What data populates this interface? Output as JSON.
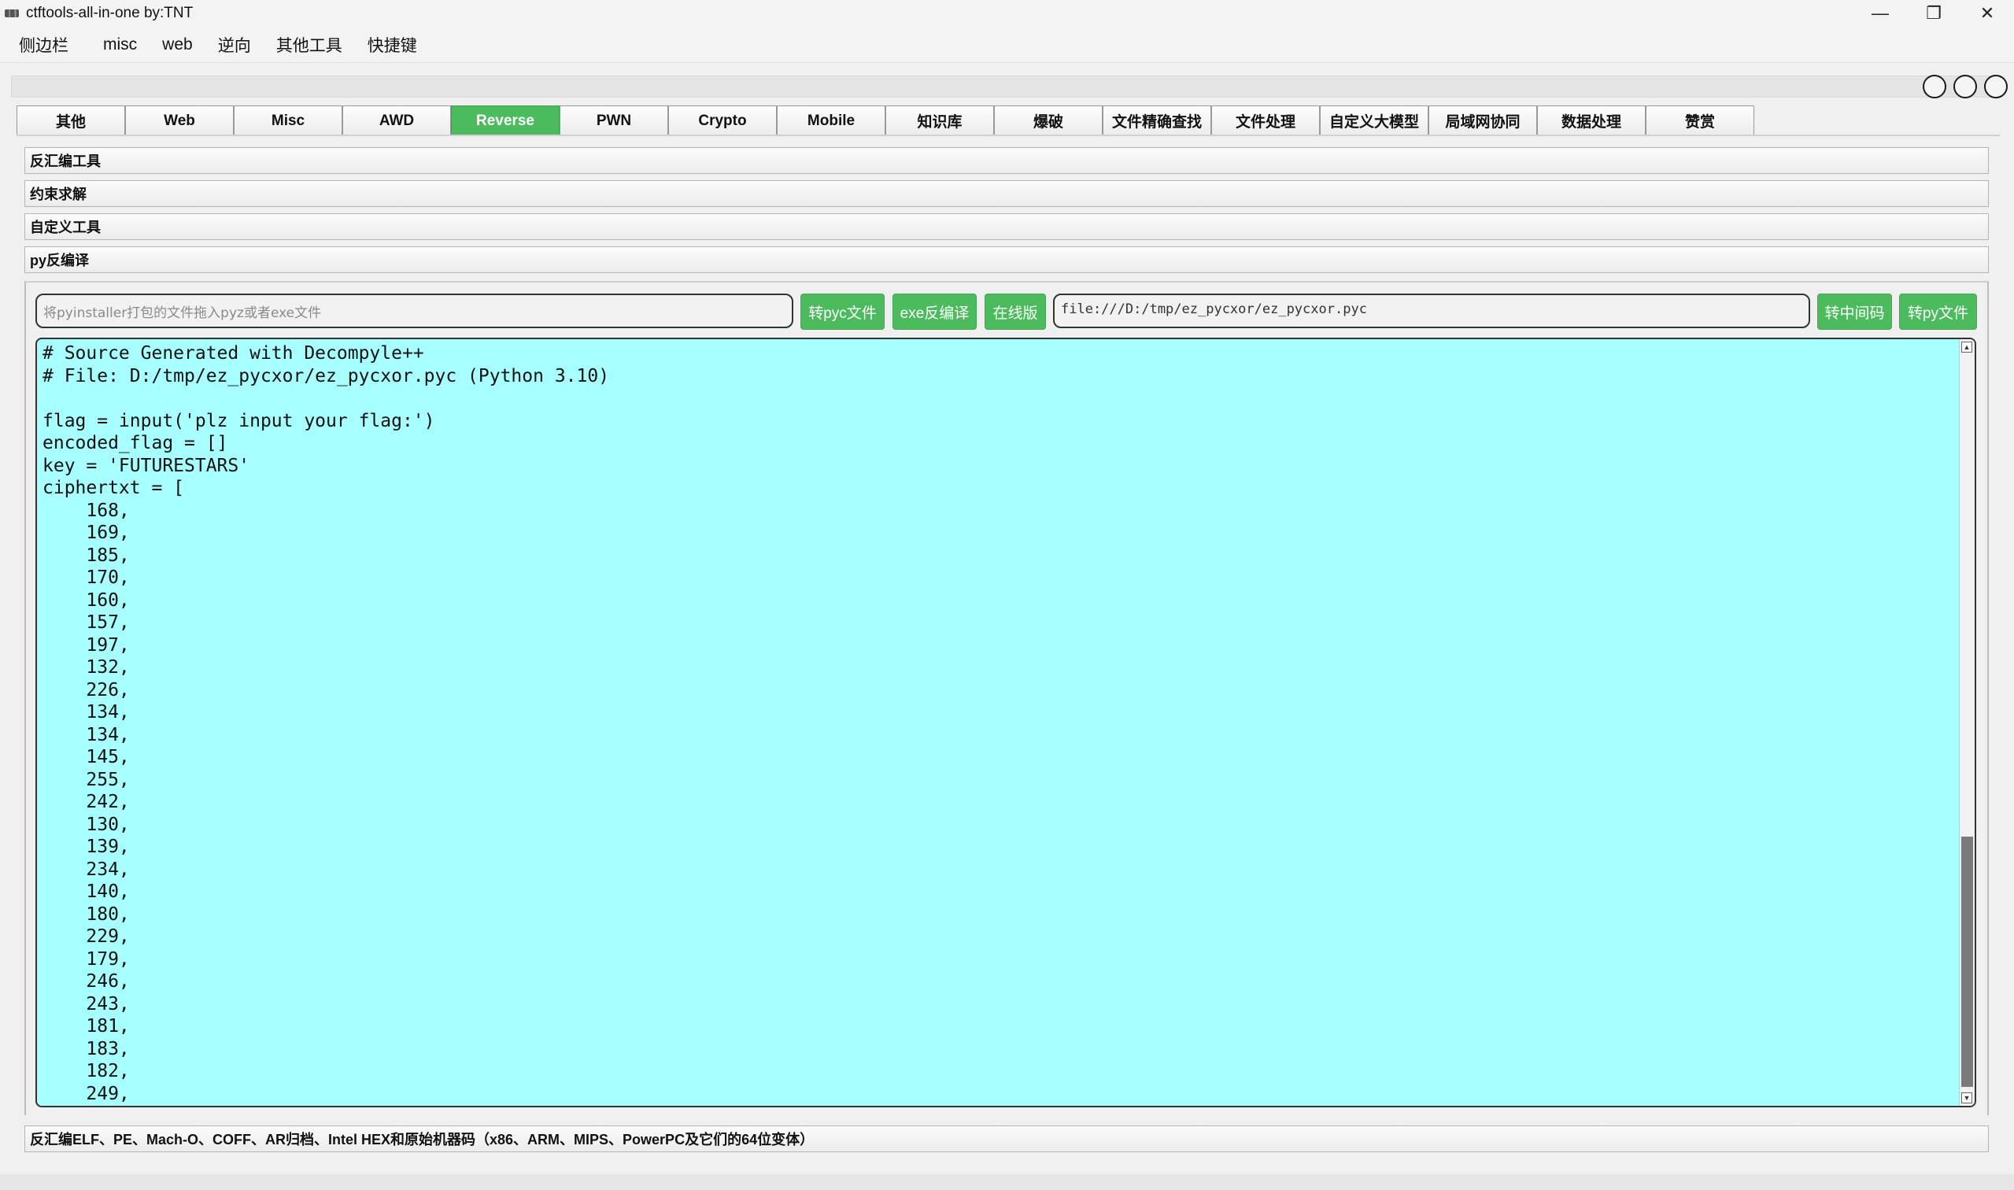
{
  "window": {
    "title": "ctftools-all-in-one   by:TNT",
    "minimize_glyph": "—",
    "restore_glyph": "❐",
    "close_glyph": "✕"
  },
  "menu": [
    "侧边栏",
    "misc",
    "web",
    "逆向",
    "其他工具",
    "快捷键"
  ],
  "tabs": [
    "其他",
    "Web",
    "Misc",
    "AWD",
    "Reverse",
    "PWN",
    "Crypto",
    "Mobile",
    "知识库",
    "爆破",
    "文件精确查找",
    "文件处理",
    "自定义大模型",
    "局域网协同",
    "数据处理",
    "赞赏"
  ],
  "active_tab": "Reverse",
  "accordion": [
    "反汇编工具",
    "约束求解",
    "自定义工具",
    "py反编译"
  ],
  "pydecompile": {
    "drop_placeholder": "将pyinstaller打包的文件拖入pyz或者exe文件",
    "buttons_left": [
      "转pyc文件",
      "exe反编译",
      "在线版"
    ],
    "path_value": "file:///D:/tmp/ez_pycxor/ez_pycxor.pyc",
    "buttons_right": [
      "转中间码",
      "转py文件"
    ],
    "code": "# Source Generated with Decompyle++\n# File: D:/tmp/ez_pycxor/ez_pycxor.pyc (Python 3.10)\n\nflag = input('plz input your flag:')\nencoded_flag = []\nkey = 'FUTURESTARS'\nciphertxt = [\n    168,\n    169,\n    185,\n    170,\n    160,\n    157,\n    197,\n    132,\n    226,\n    134,\n    134,\n    145,\n    255,\n    242,\n    130,\n    139,\n    234,\n    140,\n    180,\n    229,\n    179,\n    246,\n    243,\n    181,\n    183,\n    182,\n    249,"
  },
  "bottom_section": "反汇编ELF、PE、Mach-O、COFF、AR归档、Intel HEX和原始机器码（x86、ARM、MIPS、PowerPC及它们的64位变体）",
  "colors": {
    "accent_green": "#4cbb5e",
    "code_bg": "#a8ffff"
  }
}
